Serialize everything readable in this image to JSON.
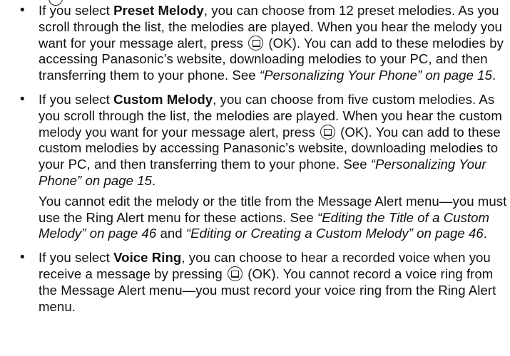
{
  "bullet_glyph": "•",
  "icons": {
    "ok_key": "ok-softkey-icon"
  },
  "items": [
    {
      "p1": {
        "t1": "If you select ",
        "b1": "Preset Melody",
        "t2": ", you can choose from 12 preset melodies. As you scroll through the list, the melodies are played. When you hear the melody you want for your message alert, press ",
        "t3": " (OK). You can add to these melodies by accessing Panasonic’s website, downloading melodies to your PC, and then transferring them to your phone. See ",
        "i1": "“Personalizing Your Phone” on page 15",
        "t4": "."
      }
    },
    {
      "p1": {
        "t1": "If you select ",
        "b1": "Custom Melody",
        "t2": ", you can choose from five custom melodies. As you scroll through the list, the melodies are played. When you hear the custom melody you want for your message alert, press ",
        "t3": " (OK). You can add to these custom melodies by accessing Panasonic’s website, downloading melodies to your PC, and then transferring them to your phone. See ",
        "i1": "“Personalizing Your Phone” on page 15",
        "t4": "."
      },
      "p2": {
        "t1": "You cannot edit the melody or the title from the Message Alert menu—you must use the Ring Alert menu for these actions. See ",
        "i1": "“Editing the Title of a Custom Melody” on page 46",
        "t2": " and ",
        "i2": "“Editing or Creating a Custom Melody” on page 46",
        "t3": "."
      }
    },
    {
      "p1": {
        "t1": "If you select ",
        "b1": "Voice Ring",
        "t2": ", you can choose to hear a recorded voice when you receive a message by pressing ",
        "t3": " (OK). You cannot record a voice ring from the Message Alert menu—you must record your voice ring from the Ring Alert menu."
      }
    }
  ]
}
